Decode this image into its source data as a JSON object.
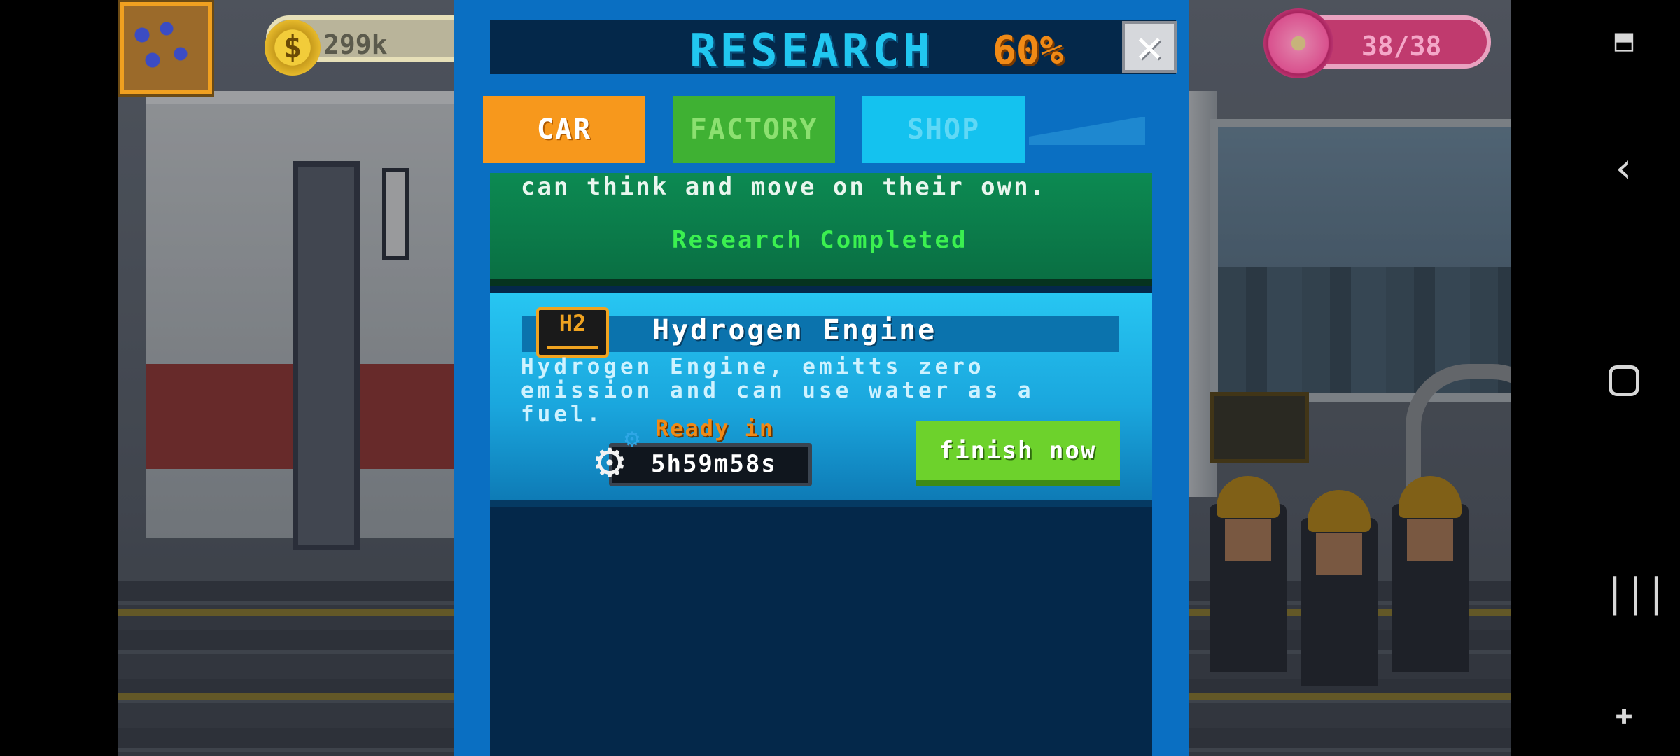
{
  "hud": {
    "money": "299k",
    "coin_symbol": "$",
    "donuts": "38/38"
  },
  "research": {
    "title": "RESEARCH",
    "percent": "60%",
    "close_symbol": "✕",
    "tabs": [
      {
        "label": "CAR",
        "active": true,
        "color": "#f7981c"
      },
      {
        "label": "FACTORY",
        "active": false,
        "color": "#3fb133"
      },
      {
        "label": "SHOP",
        "active": false,
        "color": "#14c2ef"
      }
    ],
    "completed_item": {
      "description_tail": "can think and move on their own.",
      "status": "Research Completed"
    },
    "active_item": {
      "icon": "h2-engine-icon",
      "icon_text": "H2",
      "title": "Hydrogen Engine",
      "description": "Hydrogen Engine, emitts zero emission and can use water as a fuel.",
      "ready_label": "Ready in",
      "timer": "5h59m58s",
      "finish_label": "finish now"
    }
  },
  "navbar": {
    "icons": [
      "accessibility-icon",
      "back-icon",
      "home-icon",
      "recent-apps-icon",
      "game-tools-icon"
    ]
  }
}
